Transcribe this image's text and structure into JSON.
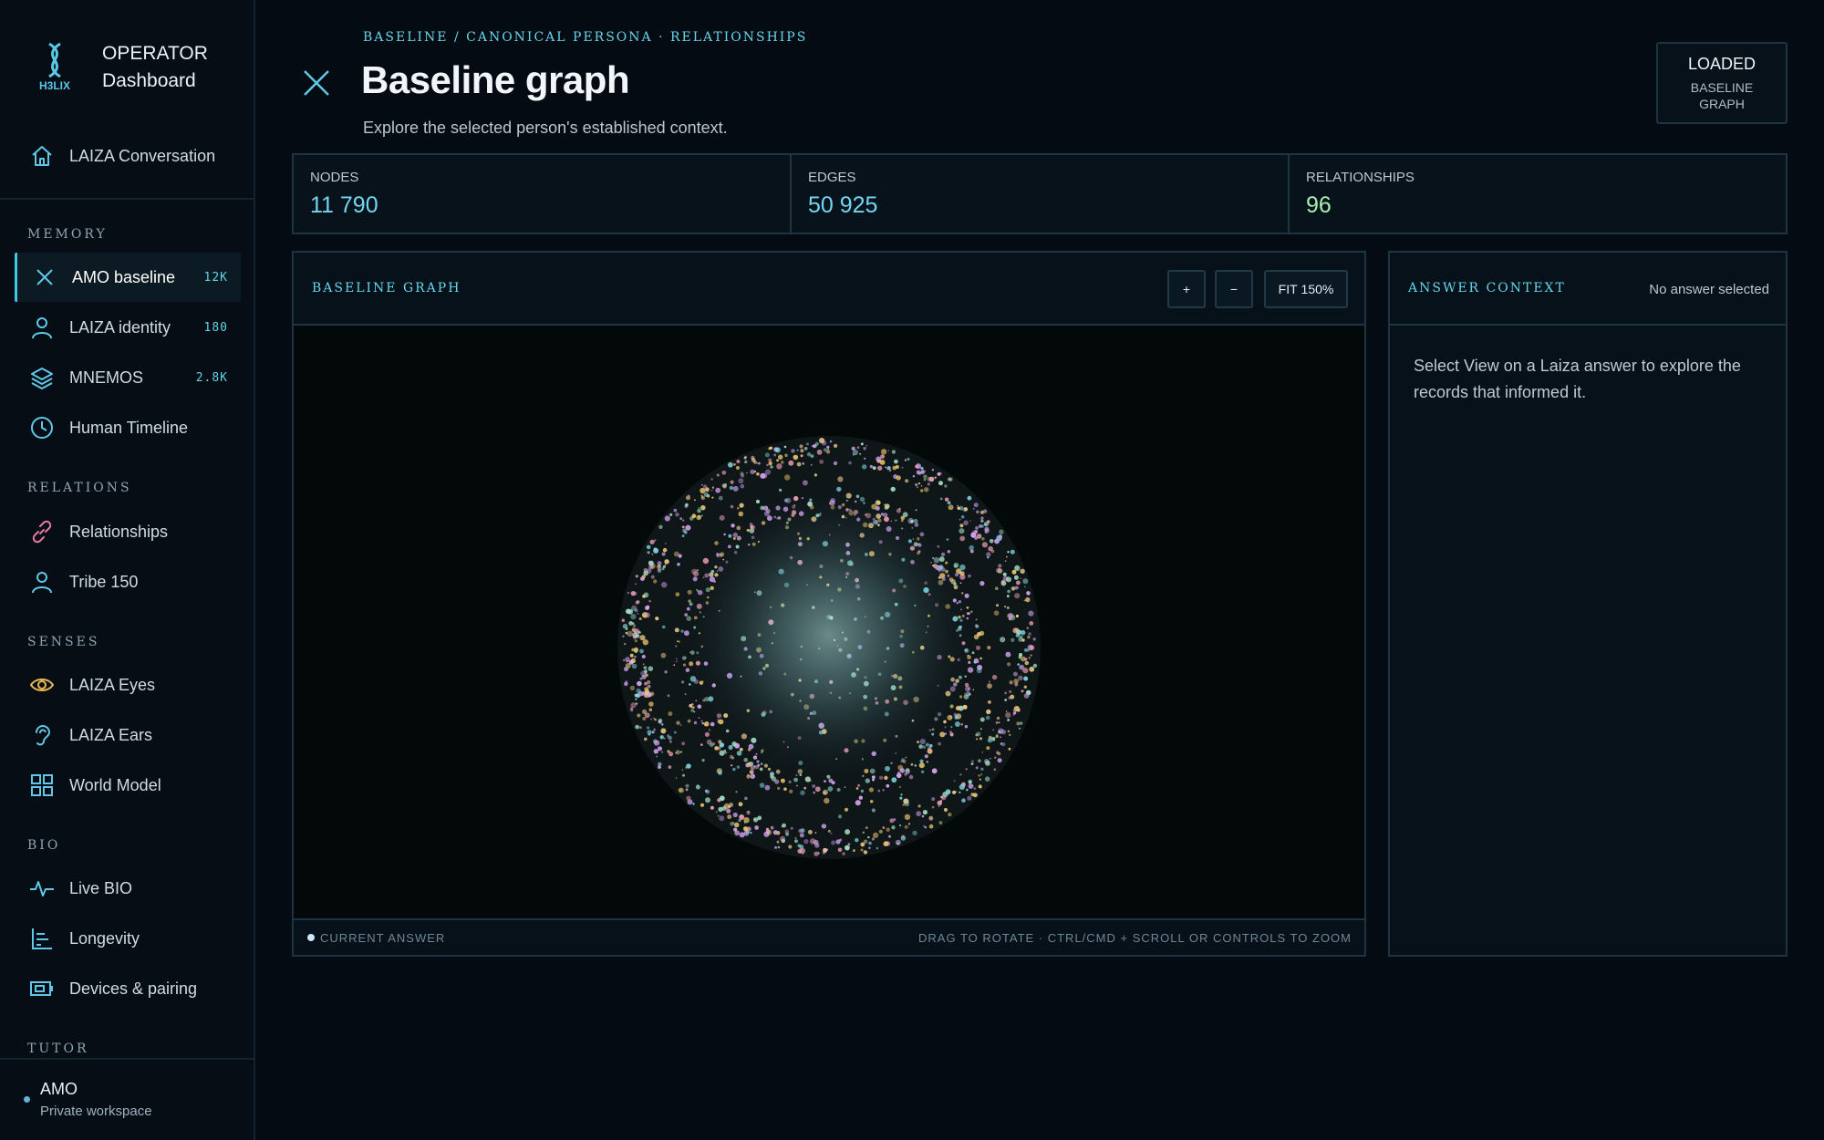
{
  "brand": {
    "logo_text": "H3LIX",
    "line1": "OPERATOR",
    "line2": "Dashboard"
  },
  "sidebar": {
    "top_item": {
      "label": "LAIZA Conversation",
      "icon": "home-icon"
    },
    "sections": [
      {
        "label": "MEMORY",
        "items": [
          {
            "label": "AMO baseline",
            "count": "12K",
            "icon": "close-x-icon",
            "active": true
          },
          {
            "label": "LAIZA identity",
            "count": "180",
            "icon": "user-icon"
          },
          {
            "label": "MNEMOS",
            "count": "2.8K",
            "icon": "layers-icon"
          },
          {
            "label": "Human Timeline",
            "icon": "clock-icon"
          }
        ]
      },
      {
        "label": "RELATIONS",
        "items": [
          {
            "label": "Relationships",
            "icon": "link-icon"
          },
          {
            "label": "Tribe 150",
            "icon": "user-icon"
          }
        ]
      },
      {
        "label": "SENSES",
        "items": [
          {
            "label": "LAIZA Eyes",
            "icon": "eye-icon"
          },
          {
            "label": "LAIZA Ears",
            "icon": "ear-icon"
          },
          {
            "label": "World Model",
            "icon": "grid-icon"
          }
        ]
      },
      {
        "label": "BIO",
        "items": [
          {
            "label": "Live BIO",
            "icon": "pulse-icon"
          },
          {
            "label": "Longevity",
            "icon": "bars-icon"
          },
          {
            "label": "Devices & pairing",
            "icon": "device-icon"
          }
        ]
      },
      {
        "label": "TUTOR",
        "items": []
      }
    ],
    "user": {
      "name": "AMO",
      "workspace": "Private workspace"
    }
  },
  "header": {
    "breadcrumb": "BASELINE / CANONICAL PERSONA · RELATIONSHIPS",
    "title": "Baseline graph",
    "subtitle": "Explore the selected person's established context.",
    "status_label": "LOADED",
    "status_value": "BASELINE GRAPH"
  },
  "stats": [
    {
      "label": "NODES",
      "value": "11 790"
    },
    {
      "label": "EDGES",
      "value": "50 925"
    },
    {
      "label": "RELATIONSHIPS",
      "value": "96"
    }
  ],
  "graph_panel": {
    "title": "BASELINE GRAPH",
    "zoom_in": "+",
    "zoom_out": "−",
    "fit_label": "FIT",
    "zoom_level": "150%",
    "legend": "CURRENT ANSWER",
    "hint": "DRAG TO ROTATE · CTRL/CMD + SCROLL OR CONTROLS TO ZOOM",
    "node_colors": [
      "#e9c46a",
      "#c79be8",
      "#f0a0b8",
      "#7fd6e0",
      "#f3d08c",
      "#a8e3c8",
      "#d8a6f2"
    ]
  },
  "answer_panel": {
    "title": "ANSWER CONTEXT",
    "status": "No answer selected",
    "body": "Select View on a Laiza answer to explore the records that informed it."
  },
  "colors": {
    "accent": "#63d6ea",
    "background": "#050b12",
    "border": "#1e3442"
  }
}
